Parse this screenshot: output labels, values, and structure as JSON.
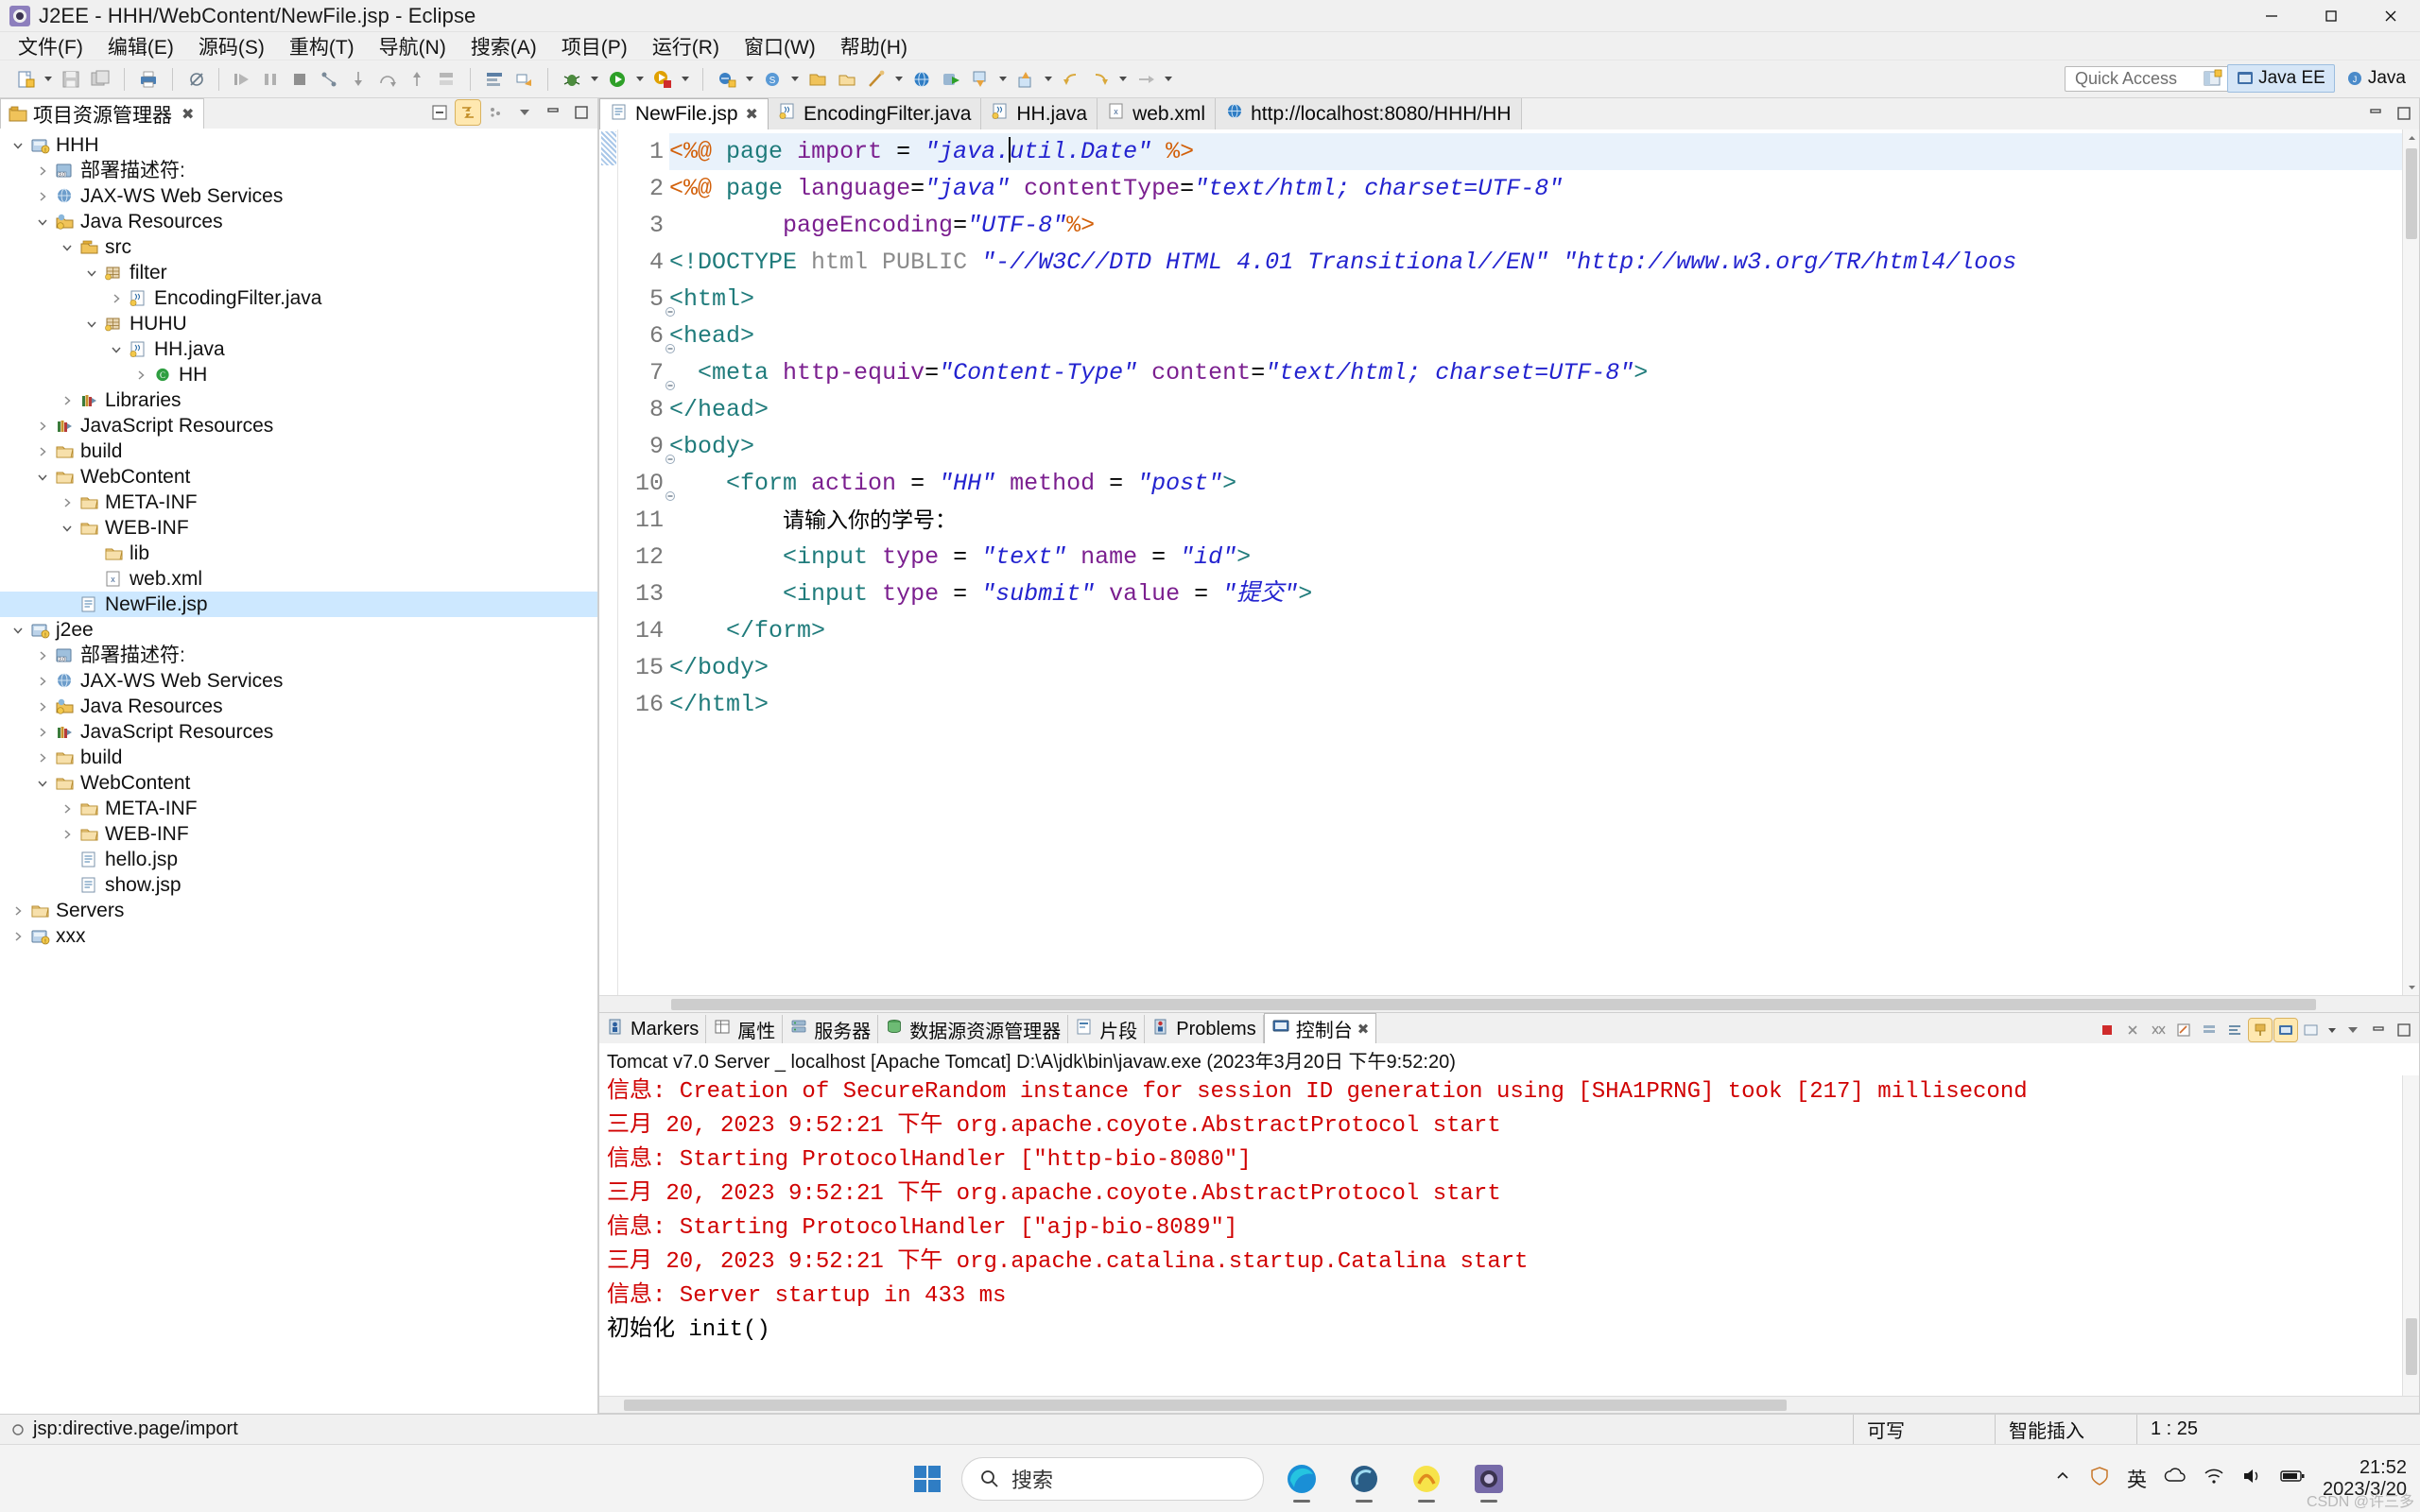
{
  "window": {
    "title": "J2EE - HHH/WebContent/NewFile.jsp - Eclipse",
    "minimize": "–",
    "maximize": "□",
    "close": "✕"
  },
  "menubar": {
    "items": [
      {
        "label": "文件(F)"
      },
      {
        "label": "编辑(E)"
      },
      {
        "label": "源码(S)"
      },
      {
        "label": "重构(T)"
      },
      {
        "label": "导航(N)"
      },
      {
        "label": "搜索(A)"
      },
      {
        "label": "项目(P)"
      },
      {
        "label": "运行(R)"
      },
      {
        "label": "窗口(W)"
      },
      {
        "label": "帮助(H)"
      }
    ]
  },
  "toolbar": {
    "quick_access_placeholder": "Quick Access",
    "perspectives": [
      {
        "label": "Java EE",
        "active": true
      },
      {
        "label": "Java",
        "active": false
      }
    ]
  },
  "explorer": {
    "tab_label": "项目资源管理器",
    "tab_close": "✖",
    "tree": [
      {
        "depth": 0,
        "label": "HHH",
        "icon": "project-icon",
        "twisty": "open"
      },
      {
        "depth": 1,
        "label": "部署描述符:",
        "icon": "deployment-descriptor-icon",
        "twisty": "closed"
      },
      {
        "depth": 1,
        "label": "JAX-WS Web Services",
        "icon": "jaxws-icon",
        "twisty": "closed"
      },
      {
        "depth": 1,
        "label": "Java Resources",
        "icon": "java-resources-icon",
        "twisty": "open"
      },
      {
        "depth": 2,
        "label": "src",
        "icon": "source-folder-icon",
        "twisty": "open"
      },
      {
        "depth": 3,
        "label": "filter",
        "icon": "package-icon",
        "twisty": "open"
      },
      {
        "depth": 4,
        "label": "EncodingFilter.java",
        "icon": "java-file-icon",
        "twisty": "closed"
      },
      {
        "depth": 3,
        "label": "HUHU",
        "icon": "package-icon",
        "twisty": "open"
      },
      {
        "depth": 4,
        "label": "HH.java",
        "icon": "java-file-icon",
        "twisty": "open"
      },
      {
        "depth": 5,
        "label": "HH",
        "icon": "class-icon",
        "twisty": "closed"
      },
      {
        "depth": 2,
        "label": "Libraries",
        "icon": "libraries-icon",
        "twisty": "closed"
      },
      {
        "depth": 1,
        "label": "JavaScript Resources",
        "icon": "libraries-icon",
        "twisty": "closed"
      },
      {
        "depth": 1,
        "label": "build",
        "icon": "folder-icon",
        "twisty": "closed"
      },
      {
        "depth": 1,
        "label": "WebContent",
        "icon": "folder-icon",
        "twisty": "open"
      },
      {
        "depth": 2,
        "label": "META-INF",
        "icon": "folder-icon",
        "twisty": "closed"
      },
      {
        "depth": 2,
        "label": "WEB-INF",
        "icon": "folder-icon",
        "twisty": "open"
      },
      {
        "depth": 3,
        "label": "lib",
        "icon": "folder-icon",
        "twisty": "none"
      },
      {
        "depth": 3,
        "label": "web.xml",
        "icon": "xml-file-icon",
        "twisty": "none"
      },
      {
        "depth": 2,
        "label": "NewFile.jsp",
        "icon": "jsp-file-icon",
        "twisty": "none",
        "selected": true
      },
      {
        "depth": 0,
        "label": "j2ee",
        "icon": "project-icon",
        "twisty": "open"
      },
      {
        "depth": 1,
        "label": "部署描述符:",
        "icon": "deployment-descriptor-icon",
        "twisty": "closed"
      },
      {
        "depth": 1,
        "label": "JAX-WS Web Services",
        "icon": "jaxws-icon",
        "twisty": "closed"
      },
      {
        "depth": 1,
        "label": "Java Resources",
        "icon": "java-resources-icon",
        "twisty": "closed"
      },
      {
        "depth": 1,
        "label": "JavaScript Resources",
        "icon": "libraries-icon",
        "twisty": "closed"
      },
      {
        "depth": 1,
        "label": "build",
        "icon": "folder-icon",
        "twisty": "closed"
      },
      {
        "depth": 1,
        "label": "WebContent",
        "icon": "folder-icon",
        "twisty": "open"
      },
      {
        "depth": 2,
        "label": "META-INF",
        "icon": "folder-icon",
        "twisty": "closed"
      },
      {
        "depth": 2,
        "label": "WEB-INF",
        "icon": "folder-icon",
        "twisty": "closed"
      },
      {
        "depth": 2,
        "label": "hello.jsp",
        "icon": "jsp-file-icon",
        "twisty": "none"
      },
      {
        "depth": 2,
        "label": "show.jsp",
        "icon": "jsp-file-icon",
        "twisty": "none"
      },
      {
        "depth": 0,
        "label": "Servers",
        "icon": "folder-icon",
        "twisty": "closed"
      },
      {
        "depth": 0,
        "label": "xxx",
        "icon": "project-icon",
        "twisty": "closed"
      }
    ]
  },
  "editor": {
    "tabs": [
      {
        "label": "NewFile.jsp",
        "icon": "jsp-file-icon",
        "active": true,
        "close": "✖"
      },
      {
        "label": "EncodingFilter.java",
        "icon": "java-file-icon",
        "active": false
      },
      {
        "label": "HH.java",
        "icon": "java-file-icon",
        "active": false
      },
      {
        "label": "web.xml",
        "icon": "xml-file-icon",
        "active": false
      },
      {
        "label": "http://localhost:8080/HHH/HH",
        "icon": "browser-icon",
        "active": false
      }
    ],
    "line_numbers": [
      "1",
      "2",
      "3",
      "4",
      "5",
      "6",
      "7",
      "8",
      "9",
      "10",
      "11",
      "12",
      "13",
      "14",
      "15",
      "16"
    ],
    "lines": [
      {
        "n": 1,
        "current": true,
        "fold": false
      },
      {
        "n": 2,
        "current": false,
        "fold": false
      },
      {
        "n": 3,
        "current": false,
        "fold": false
      },
      {
        "n": 4,
        "current": false,
        "fold": false
      },
      {
        "n": 5,
        "current": false,
        "fold": true
      },
      {
        "n": 6,
        "current": false,
        "fold": true
      },
      {
        "n": 7,
        "current": false,
        "fold": true
      },
      {
        "n": 8,
        "current": false,
        "fold": false
      },
      {
        "n": 9,
        "current": false,
        "fold": true
      },
      {
        "n": 10,
        "current": false,
        "fold": true
      },
      {
        "n": 11,
        "current": false,
        "fold": false
      },
      {
        "n": 12,
        "current": false,
        "fold": false
      },
      {
        "n": 13,
        "current": false,
        "fold": false
      },
      {
        "n": 14,
        "current": false,
        "fold": false
      },
      {
        "n": 15,
        "current": false,
        "fold": false
      },
      {
        "n": 16,
        "current": false,
        "fold": false
      }
    ],
    "source_text": [
      "<%@ page import = \"java.util.Date\" %>",
      "<%@ page language=\"java\" contentType=\"text/html; charset=UTF-8\"",
      "        pageEncoding=\"UTF-8\"%>",
      "<!DOCTYPE html PUBLIC \"-//W3C//DTD HTML 4.01 Transitional//EN\" \"http://www.w3.org/TR/html4/loos",
      "<html>",
      "<head>",
      "  <meta http-equiv=\"Content-Type\" content=\"text/html; charset=UTF-8\">",
      "</head>",
      "<body>",
      "    <form action = \"HH\" method = \"post\">",
      "        请输入你的学号：",
      "        <input type = \"text\" name = \"id\">",
      "        <input type = \"submit\" value = \"提交\">",
      "    </form>",
      "</body>",
      "</html>"
    ]
  },
  "console": {
    "tabs": [
      {
        "label": "Markers",
        "icon": "markers-icon",
        "active": false
      },
      {
        "label": "属性",
        "icon": "properties-icon",
        "active": false
      },
      {
        "label": "服务器",
        "icon": "servers-icon",
        "active": false
      },
      {
        "label": "数据源资源管理器",
        "icon": "datasource-icon",
        "active": false
      },
      {
        "label": "片段",
        "icon": "snippets-icon",
        "active": false
      },
      {
        "label": "Problems",
        "icon": "problems-icon",
        "active": false
      },
      {
        "label": "控制台",
        "icon": "console-icon",
        "active": true,
        "close": "✖"
      }
    ],
    "process_line": "Tomcat v7.0 Server _ localhost [Apache Tomcat] D:\\A\\jdk\\bin\\javaw.exe  (2023年3月20日 下午9:52:20)",
    "output": [
      {
        "text": "信息: Creation of SecureRandom instance for session ID generation using [SHA1PRNG] took [217] millisecond",
        "color": "#d00000"
      },
      {
        "text": "三月 20, 2023 9:52:21 下午 org.apache.coyote.AbstractProtocol start",
        "color": "#d00000"
      },
      {
        "text": "信息: Starting ProtocolHandler [\"http-bio-8080\"]",
        "color": "#d00000"
      },
      {
        "text": "三月 20, 2023 9:52:21 下午 org.apache.coyote.AbstractProtocol start",
        "color": "#d00000"
      },
      {
        "text": "信息: Starting ProtocolHandler [\"ajp-bio-8089\"]",
        "color": "#d00000"
      },
      {
        "text": "三月 20, 2023 9:52:21 下午 org.apache.catalina.startup.Catalina start",
        "color": "#d00000"
      },
      {
        "text": "信息: Server startup in 433 ms",
        "color": "#d00000"
      },
      {
        "text": "初始化 init()",
        "color": "#000000"
      }
    ]
  },
  "statusbar": {
    "selection_label": "jsp:directive.page/import",
    "writable": "可写",
    "insert_mode": "智能插入",
    "position": "1 : 25"
  },
  "taskbar": {
    "search_placeholder": "搜索",
    "clock_time": "21:52",
    "clock_date": "2023/3/20",
    "language": "英",
    "watermark": "CSDN @许三多"
  }
}
